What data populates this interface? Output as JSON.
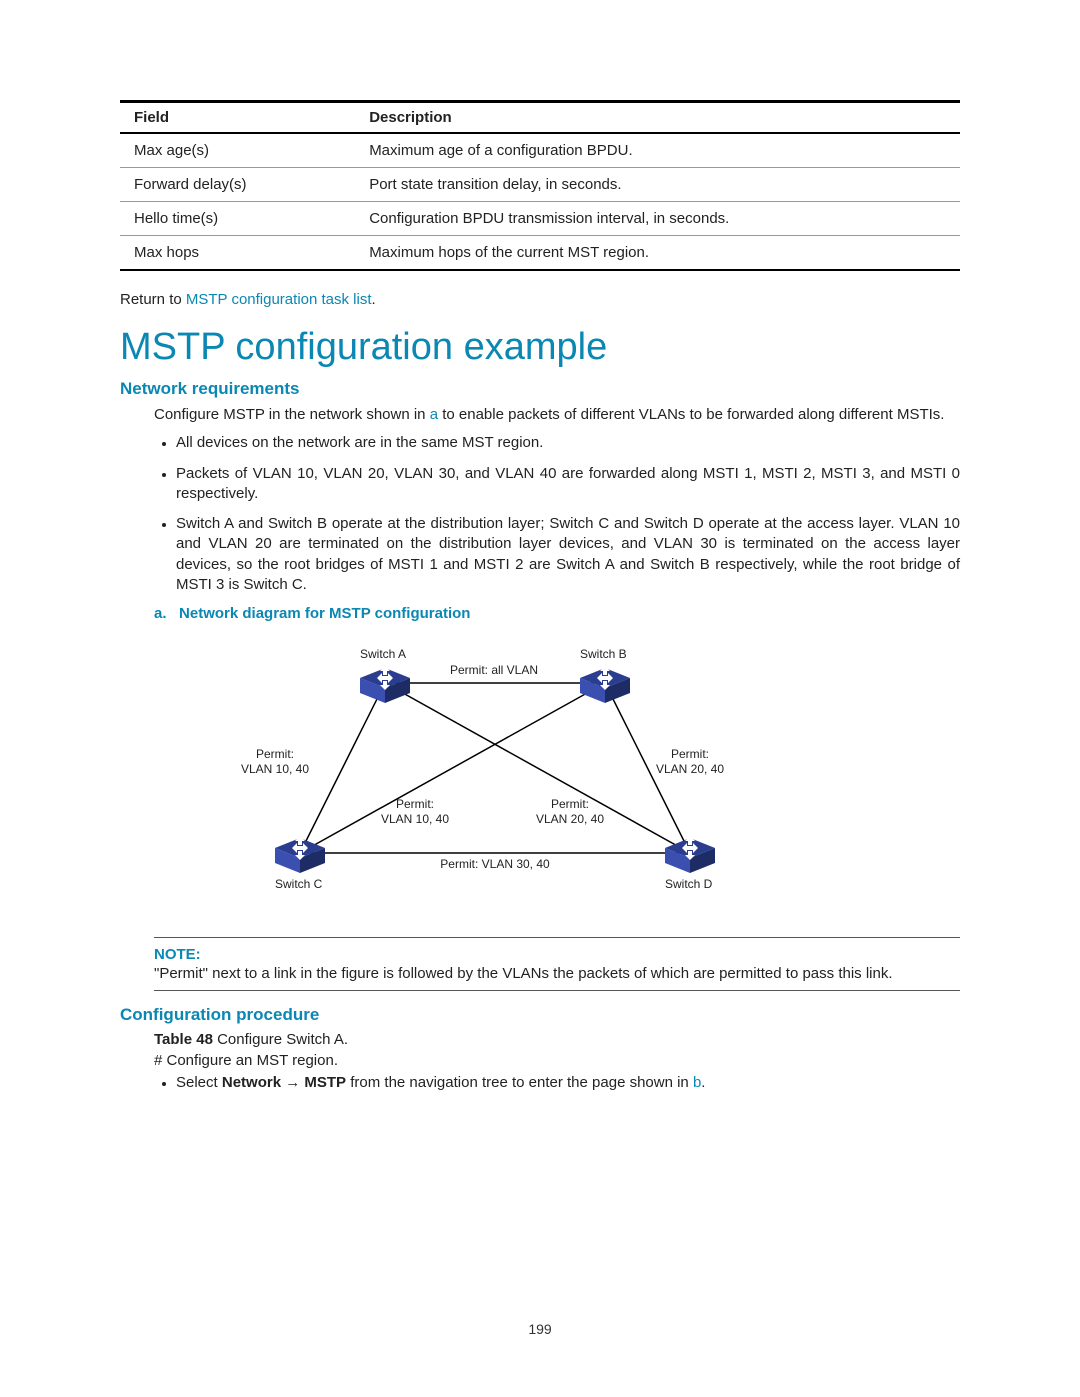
{
  "table": {
    "headers": [
      "Field",
      "Description"
    ],
    "rows": [
      [
        "Max age(s)",
        "Maximum age of a configuration BPDU."
      ],
      [
        "Forward delay(s)",
        "Port state transition delay, in seconds."
      ],
      [
        "Hello time(s)",
        "Configuration BPDU transmission interval, in seconds."
      ],
      [
        "Max hops",
        "Maximum hops of the current MST region."
      ]
    ]
  },
  "return_line": {
    "prefix": "Return to ",
    "link": "MSTP configuration task list",
    "suffix": "."
  },
  "title": "MSTP configuration example",
  "net_req_heading": "Network requirements",
  "net_req_intro_1": "Configure MSTP in the network shown in ",
  "net_req_intro_link": "a",
  "net_req_intro_2": " to enable packets of different VLANs to be forwarded along different MSTIs.",
  "bullets": [
    "All devices on the network are in the same MST region.",
    "Packets of VLAN 10, VLAN 20, VLAN 30, and VLAN 40 are forwarded along MSTI 1, MSTI 2, MSTI 3, and MSTI 0 respectively.",
    "Switch A and Switch B operate at the distribution layer; Switch C and Switch D operate at the access layer. VLAN 10 and VLAN 20 are terminated on the distribution layer devices, and VLAN 30 is terminated on the access layer devices, so the root bridges of MSTI 1 and MSTI 2 are Switch A and Switch B respectively, while the root bridge of MSTI 3 is Switch C."
  ],
  "figure_caption_prefix": "a.",
  "figure_caption_text": "Network diagram for MSTP configuration",
  "diagram": {
    "nodes": {
      "switch_a": "Switch A",
      "switch_b": "Switch B",
      "switch_c": "Switch C",
      "switch_d": "Switch D"
    },
    "labels": {
      "top": "Permit: all VLAN",
      "left": "Permit:",
      "left2": "VLAN 10, 40",
      "right": "Permit:",
      "right2": "VLAN 20, 40",
      "midleft": "Permit:",
      "midleft2": "VLAN 10, 40",
      "midright": "Permit:",
      "midright2": "VLAN 20, 40",
      "bottom": "Permit: VLAN 30, 40"
    }
  },
  "note_label": "NOTE:",
  "note_text": "\"Permit\" next to a link in the figure is followed by the VLANs the packets of which are permitted to pass this link.",
  "conf_heading": "Configuration procedure",
  "conf_table_label_bold": "Table 48",
  "conf_table_label_rest": " Configure Switch A.",
  "conf_step1": "# Configure an MST region.",
  "conf_bullet_1a": "Select ",
  "conf_bullet_1b_bold": "Network",
  "conf_bullet_arrow": " → ",
  "conf_bullet_1c_bold": "MSTP",
  "conf_bullet_1d": " from the navigation tree to enter the page shown in ",
  "conf_bullet_link": "b",
  "conf_bullet_end": ".",
  "page_number": "199"
}
